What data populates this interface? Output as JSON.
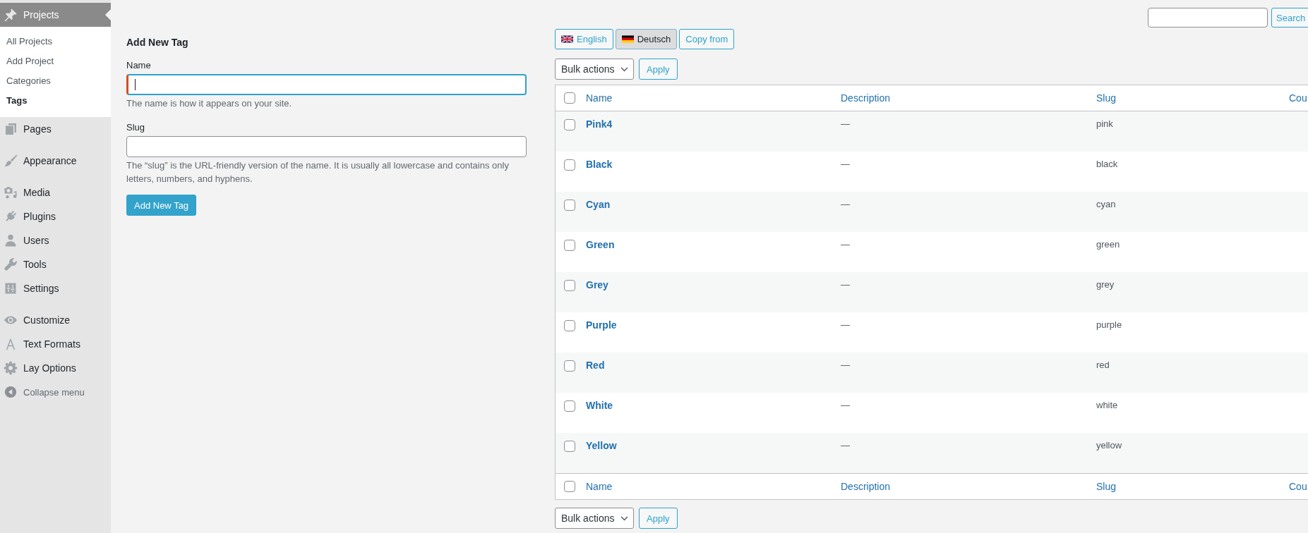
{
  "sidebar": {
    "menu_groups": [
      [
        {
          "label": "Projects",
          "selected": true,
          "submenu": [
            {
              "label": "All Projects",
              "selected": false
            },
            {
              "label": "Add Project",
              "selected": false
            },
            {
              "label": "Categories",
              "selected": false
            },
            {
              "label": "Tags",
              "selected": true
            }
          ]
        },
        {
          "label": "Pages",
          "selected": false
        }
      ],
      [
        {
          "label": "Appearance",
          "selected": false
        }
      ],
      [
        {
          "label": "Media",
          "selected": false
        },
        {
          "label": "Plugins",
          "selected": false
        },
        {
          "label": "Users",
          "selected": false
        },
        {
          "label": "Tools",
          "selected": false
        },
        {
          "label": "Settings",
          "selected": false
        }
      ],
      [
        {
          "label": "Customize",
          "selected": false
        },
        {
          "label": "Text Formats",
          "selected": false
        },
        {
          "label": "Lay Options",
          "selected": false
        }
      ]
    ],
    "collapse_label": "Collapse menu"
  },
  "search": {
    "button": "Search"
  },
  "add_form": {
    "heading": "Add New Tag",
    "fields": [
      {
        "label": "Name",
        "focused": true,
        "hint": "The name is how it appears on your site."
      },
      {
        "label": "Slug",
        "focused": false,
        "hint": "The “slug” is the URL-friendly version of the name. It is usually all lowercase and contains only letters, numbers, and hyphens."
      }
    ],
    "submit": "Add New Tag"
  },
  "language_buttons": [
    {
      "label": "English",
      "selected": false
    },
    {
      "label": "Deutsch",
      "selected": true
    }
  ],
  "copy_button": "Copy from",
  "bulk_top": {
    "select": "Bulk actions",
    "apply": "Apply"
  },
  "table": {
    "columns": [
      "Name",
      "Description",
      "Slug",
      "Cou"
    ],
    "header_checked": false,
    "rows": [
      {
        "name": "Pink4",
        "description": "—",
        "slug": "pink",
        "checked": false
      },
      {
        "name": "Black",
        "description": "—",
        "slug": "black",
        "checked": false
      },
      {
        "name": "Cyan",
        "description": "—",
        "slug": "cyan",
        "checked": false
      },
      {
        "name": "Green",
        "description": "—",
        "slug": "green",
        "checked": false
      },
      {
        "name": "Grey",
        "description": "—",
        "slug": "grey",
        "checked": false
      },
      {
        "name": "Purple",
        "description": "—",
        "slug": "purple",
        "checked": false
      },
      {
        "name": "Red",
        "description": "—",
        "slug": "red",
        "checked": false
      },
      {
        "name": "White",
        "description": "—",
        "slug": "white",
        "checked": false
      },
      {
        "name": "Yellow",
        "description": "—",
        "slug": "yellow",
        "checked": false
      }
    ],
    "footer_columns": [
      "Name",
      "Description",
      "Slug",
      "Cou"
    ],
    "footer_checked": false
  },
  "bulk_bottom": {
    "select": "Bulk actions",
    "apply": "Apply"
  }
}
